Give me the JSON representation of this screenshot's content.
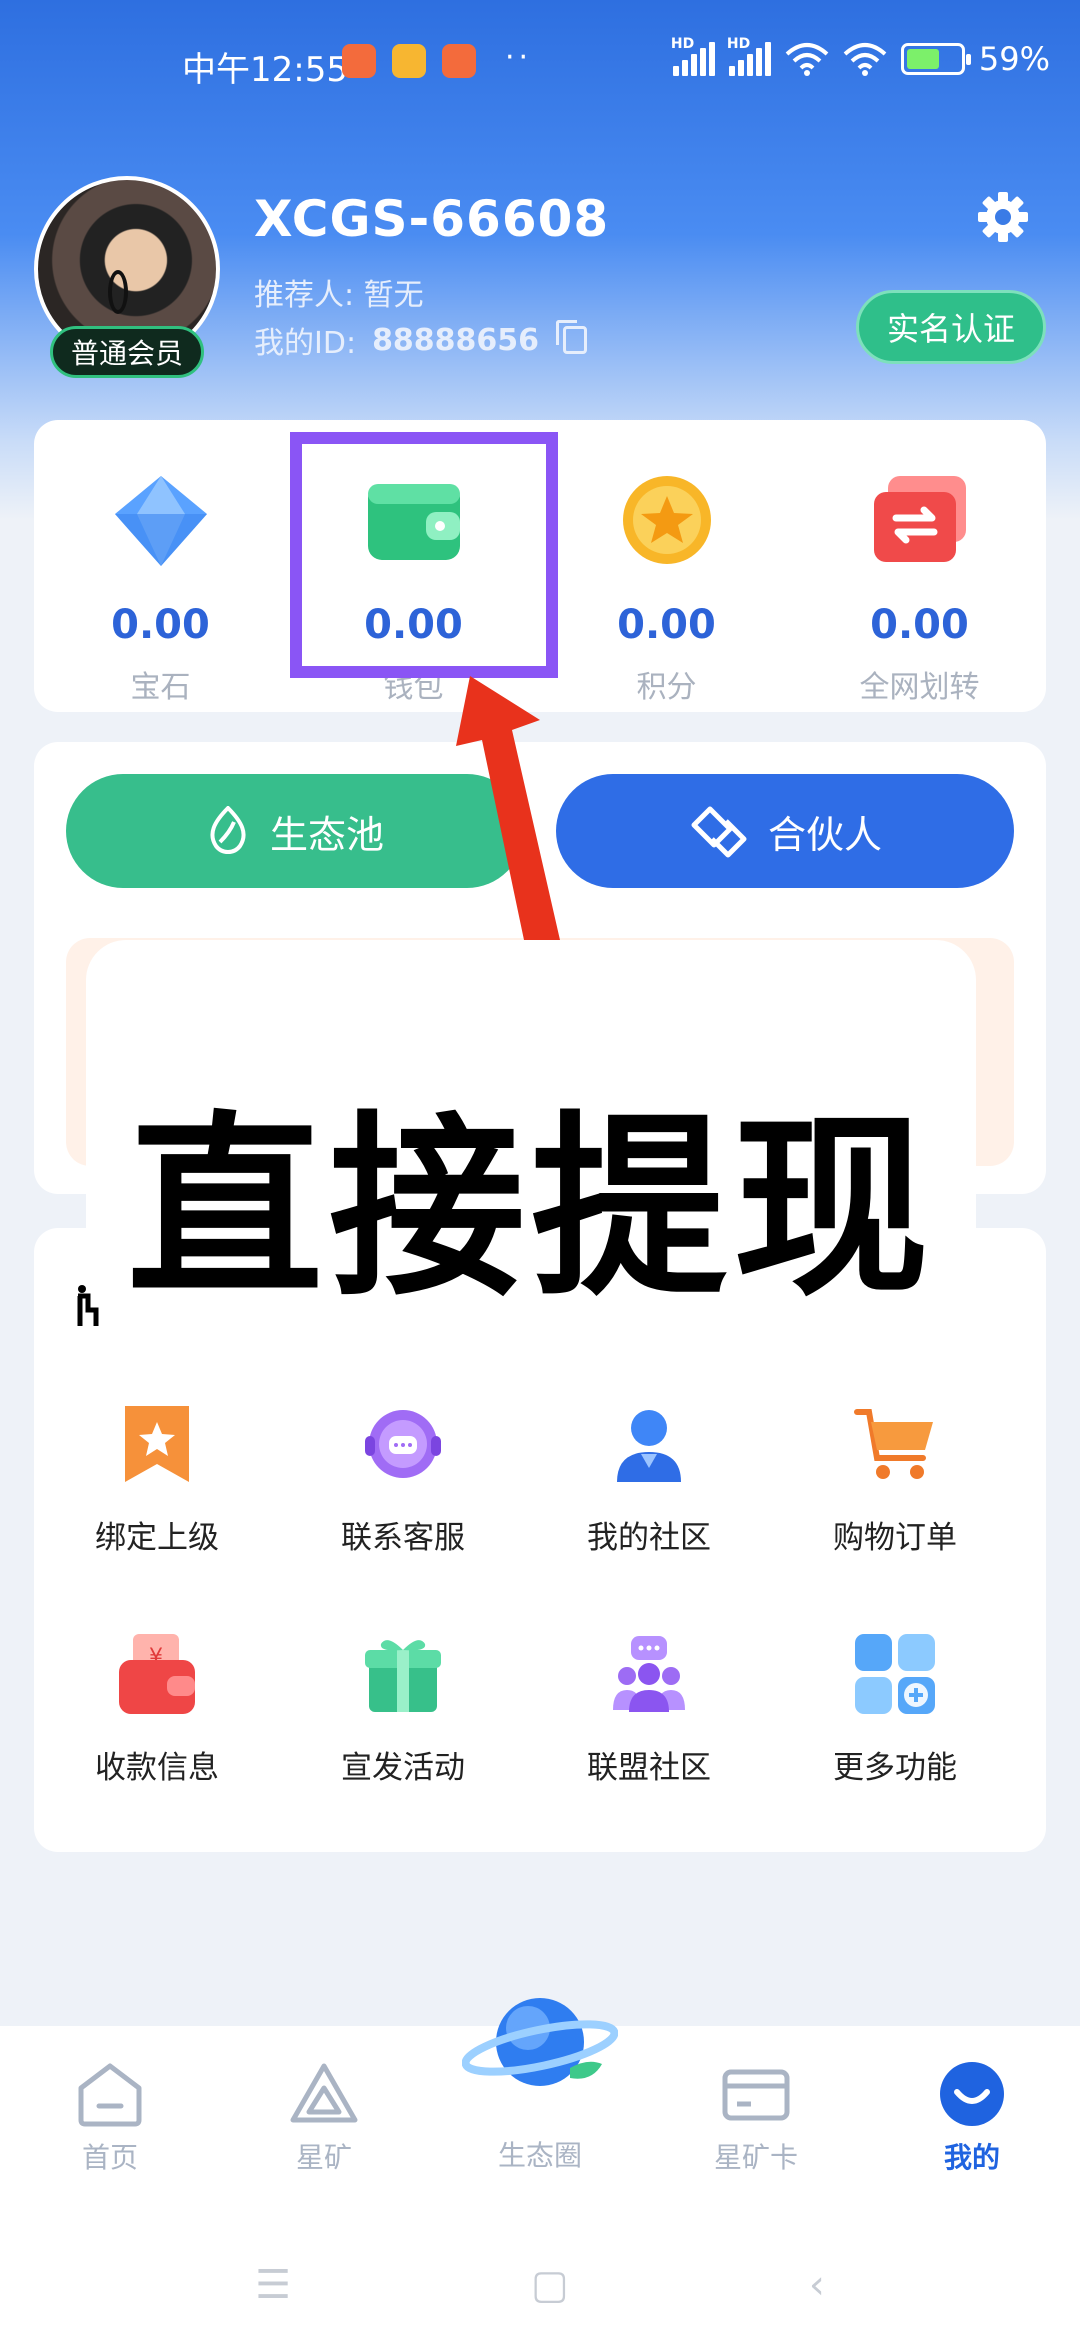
{
  "status_bar": {
    "time": "中午12:55",
    "dots": "··",
    "battery": "59%",
    "hd": "HD"
  },
  "profile": {
    "username": "XCGS-66608",
    "referrer": "推荐人: 暂无",
    "my_id_label": "我的ID:",
    "my_id": "88888656",
    "member_level": "普通会员",
    "verify_label": "实名认证"
  },
  "assets": [
    {
      "value": "0.00",
      "label": "宝石",
      "icon": "gem-icon"
    },
    {
      "value": "0.00",
      "label": "钱包",
      "icon": "wallet-icon"
    },
    {
      "value": "0.00",
      "label": "积分",
      "icon": "star-coin-icon"
    },
    {
      "value": "0.00",
      "label": "全网划转",
      "icon": "transfer-icon"
    }
  ],
  "actions": {
    "pool_label": "生态池",
    "partner_label": "合伙人"
  },
  "overlay": {
    "text": "直接提现"
  },
  "grid": [
    {
      "label": "绑定上级",
      "icon": "bookmark-star-icon"
    },
    {
      "label": "联系客服",
      "icon": "headset-chat-icon"
    },
    {
      "label": "我的社区",
      "icon": "user-community-icon"
    },
    {
      "label": "购物订单",
      "icon": "shopping-cart-icon"
    },
    {
      "label": "收款信息",
      "icon": "payment-wallet-icon"
    },
    {
      "label": "宣发活动",
      "icon": "gift-icon"
    },
    {
      "label": "联盟社区",
      "icon": "alliance-group-icon"
    },
    {
      "label": "更多功能",
      "icon": "more-apps-icon"
    }
  ],
  "tabs": [
    {
      "label": "首页",
      "icon": "home-icon"
    },
    {
      "label": "星矿",
      "icon": "mine-triangle-icon"
    },
    {
      "label": "生态圈",
      "icon": "planet-icon"
    },
    {
      "label": "星矿卡",
      "icon": "card-icon"
    },
    {
      "label": "我的",
      "icon": "profile-smile-icon"
    }
  ],
  "colors": {
    "accent": "#2f6de6",
    "green": "#37be8c",
    "highlight": "#8a55f5",
    "arrow": "#e8321c"
  }
}
